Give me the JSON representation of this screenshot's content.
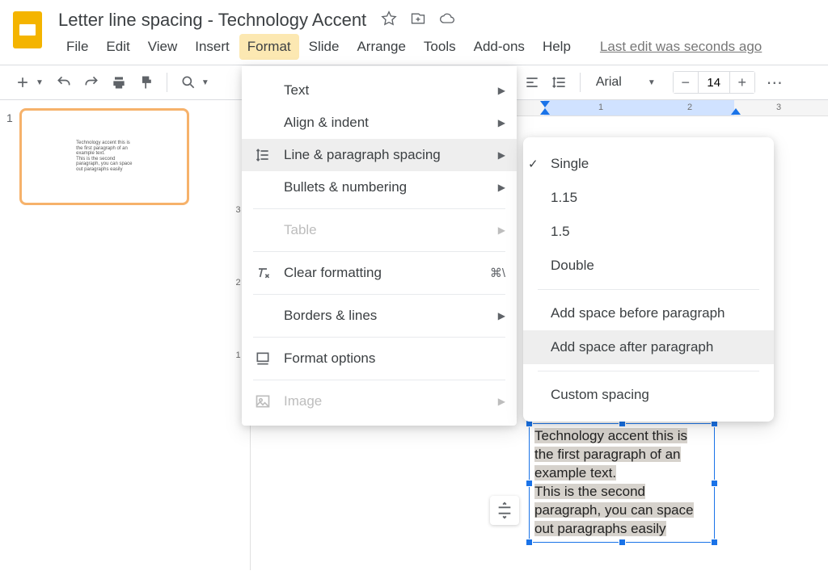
{
  "header": {
    "doc_title": "Letter line spacing - Technology Accent",
    "last_edit": "Last edit was seconds ago",
    "menu": [
      "File",
      "Edit",
      "View",
      "Insert",
      "Format",
      "Slide",
      "Arrange",
      "Tools",
      "Add-ons",
      "Help"
    ],
    "active_menu_index": 4
  },
  "toolbar": {
    "font": "Arial",
    "font_size": "14"
  },
  "sidebar": {
    "slide_number": "1",
    "thumb_lines": [
      "Technology accent this is",
      "the first paragraph of an",
      "example text.",
      "This is the second",
      "paragraph, you can space",
      "out paragraphs easily"
    ]
  },
  "ruler": {
    "v_marks": [
      "3",
      "2",
      "1"
    ],
    "h_marks": [
      "1",
      "2",
      "3"
    ]
  },
  "format_menu": {
    "items": [
      {
        "label": "Text",
        "arrow": true
      },
      {
        "label": "Align & indent",
        "arrow": true
      },
      {
        "label": "Line & paragraph spacing",
        "arrow": true,
        "icon": "line-spacing",
        "highlighted": true
      },
      {
        "label": "Bullets & numbering",
        "arrow": true
      },
      {
        "divider": true
      },
      {
        "label": "Table",
        "arrow": true,
        "disabled": true
      },
      {
        "divider": true
      },
      {
        "label": "Clear formatting",
        "icon": "clear-format",
        "shortcut": "⌘\\"
      },
      {
        "divider": true
      },
      {
        "label": "Borders & lines",
        "arrow": true
      },
      {
        "divider": true
      },
      {
        "label": "Format options",
        "icon": "format-options"
      },
      {
        "divider": true
      },
      {
        "label": "Image",
        "arrow": true,
        "icon": "image",
        "disabled": true
      }
    ]
  },
  "spacing_submenu": {
    "items": [
      {
        "label": "Single",
        "checked": true
      },
      {
        "label": "1.15"
      },
      {
        "label": "1.5"
      },
      {
        "label": "Double"
      },
      {
        "divider": true
      },
      {
        "label": "Add space before paragraph"
      },
      {
        "label": "Add space after paragraph",
        "highlighted": true
      },
      {
        "divider": true
      },
      {
        "label": "Custom spacing"
      }
    ]
  },
  "textbox": {
    "line1": "Technology accent this is",
    "line2": "the first paragraph of an",
    "line3": "example text.",
    "line4": "This is the second",
    "line5": "paragraph, you can space",
    "line6": "out paragraphs easily"
  }
}
